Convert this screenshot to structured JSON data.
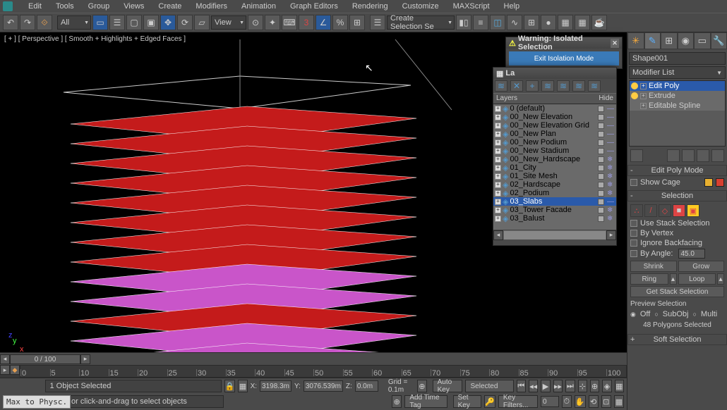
{
  "menus": [
    "Edit",
    "Tools",
    "Group",
    "Views",
    "Create",
    "Modifiers",
    "Animation",
    "Graph Editors",
    "Rendering",
    "Customize",
    "MAXScript",
    "Help"
  ],
  "dropdowns": {
    "all": "All",
    "view": "View",
    "selset": "Create Selection Se"
  },
  "viewport_label": "[ + ] [ Perspective ] [ Smooth + Highlights + Edged Faces ]",
  "object_name": "Shape001",
  "modifier_list_label": "Modifier List",
  "stack": [
    {
      "label": "Edit Poly",
      "active": true,
      "expandable": true
    },
    {
      "label": "Extrude",
      "active": false,
      "expandable": true
    },
    {
      "label": "Editable Spline",
      "active": false,
      "expandable": true
    }
  ],
  "rollouts": {
    "edit_poly_mode": "Edit Poly Mode",
    "show_cage": "Show Cage",
    "selection": "Selection",
    "use_stack": "Use Stack Selection",
    "by_vertex": "By Vertex",
    "ignore_backfacing": "Ignore Backfacing",
    "by_angle": "By Angle:",
    "angle_val": "45.0",
    "shrink": "Shrink",
    "grow": "Grow",
    "ring": "Ring",
    "loop": "Loop",
    "get_stack_sel": "Get Stack Selection",
    "preview": "Preview Selection",
    "off": "Off",
    "subobj": "SubObj",
    "multi": "Multi",
    "sel_count": "48 Polygons Selected",
    "soft_sel": "Soft Selection"
  },
  "isolation": {
    "title": "Warning: Isolated Selection",
    "button": "Exit Isolation Mode"
  },
  "layers_panel": {
    "title_short": "La",
    "col_layers": "Layers",
    "col_hide": "Hide",
    "items": [
      "0 (default)",
      "00_New Elevation",
      "00_New Elevation Grid",
      "00_New Plan",
      "00_New Podium",
      "00_New Stadium",
      "00_New_Hardscape",
      "01_City",
      "01_Site Mesh",
      "02_Hardscape",
      "02_Podium",
      "03_Slabs",
      "03_Tower Facade",
      "03_Balust"
    ],
    "selected_index": 11
  },
  "timeline": {
    "pos": "0 / 100",
    "ticks": [
      0,
      5,
      10,
      15,
      20,
      25,
      30,
      35,
      40,
      45,
      50,
      55,
      60,
      65,
      70,
      75,
      80,
      85,
      90,
      95,
      100
    ]
  },
  "status": {
    "selected": "1 Object Selected",
    "prompt": "Click or click-and-drag to select objects",
    "x": "3198.3m",
    "y": "3076.539m",
    "z": "0.0m",
    "grid": "Grid = 0.1m",
    "autokey": "Auto Key",
    "setkey": "Set Key",
    "selected_lbl": "Selected",
    "keyfilters": "Key Filters...",
    "addtag": "Add Time Tag",
    "script_btn": "Max to Physc."
  },
  "colors": {
    "cage_a": "#e8b030",
    "cage_b": "#d84030",
    "poly_on": "#ffcc22"
  }
}
